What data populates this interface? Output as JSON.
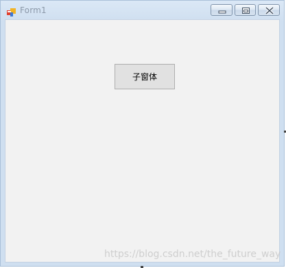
{
  "window": {
    "title": "Form1"
  },
  "titlebar": {
    "app_icon": "winforms-app-icon",
    "controls": {
      "minimize_icon": "minimize-icon",
      "restore_icon": "restore-icon",
      "close_icon": "close-icon"
    }
  },
  "main": {
    "child_button_label": "子窗体"
  },
  "watermark": {
    "text": "https://blog.csdn.net/the_future_way"
  },
  "colors": {
    "client_background": "#f2f2f2",
    "button_background": "#e1e1e1",
    "button_border": "#adadad",
    "titlebar": "#cfdff0",
    "title_text": "#8b98a8"
  }
}
